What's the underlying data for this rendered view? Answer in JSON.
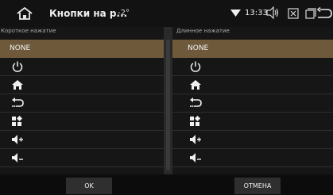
{
  "header": {
    "title": "Кнопки на р...",
    "temperature": "-2°",
    "time": "13:33",
    "icons": [
      "home-icon",
      "wifi-icon",
      "volume-icon",
      "close-box-icon",
      "windows-icon",
      "back-icon"
    ]
  },
  "colors": {
    "selected_row": "#6e5a3b",
    "background": "#1c1c1c",
    "topbar": "#121212"
  },
  "short_press": {
    "label": "Короткое нажатие",
    "options": [
      {
        "type": "text",
        "text": "NONE",
        "selected": true
      },
      {
        "type": "icon",
        "icon": "power-icon"
      },
      {
        "type": "icon",
        "icon": "home-icon"
      },
      {
        "type": "icon",
        "icon": "back-arrow-icon"
      },
      {
        "type": "icon",
        "icon": "apps-icon"
      },
      {
        "type": "icon",
        "icon": "volume-up-icon"
      },
      {
        "type": "icon",
        "icon": "volume-down-icon"
      }
    ]
  },
  "long_press": {
    "label": "Длинное нажатие",
    "options": [
      {
        "type": "text",
        "text": "NONE",
        "selected": true
      },
      {
        "type": "icon",
        "icon": "power-icon"
      },
      {
        "type": "icon",
        "icon": "home-icon"
      },
      {
        "type": "icon",
        "icon": "back-arrow-icon"
      },
      {
        "type": "icon",
        "icon": "apps-icon"
      },
      {
        "type": "icon",
        "icon": "volume-up-icon"
      },
      {
        "type": "icon",
        "icon": "volume-down-icon"
      }
    ]
  },
  "footer": {
    "ok_label": "OK",
    "cancel_label": "ОТМЕНА"
  }
}
